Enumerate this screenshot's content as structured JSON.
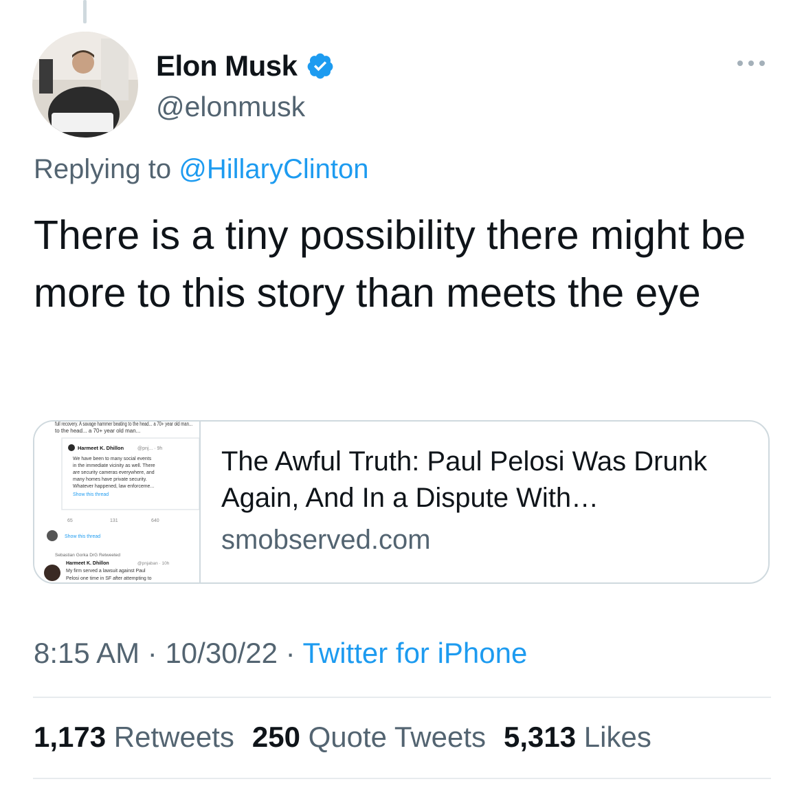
{
  "tweet": {
    "author": {
      "display_name": "Elon Musk",
      "handle": "@elonmusk",
      "verified": true
    },
    "replying_to_prefix": "Replying to",
    "replying_to_handle": "@HillaryClinton",
    "text": "There is a tiny possibility there might be more to this story than meets the eye",
    "card": {
      "title": "The Awful Truth: Paul Pelosi Was Drunk Again, And In a Dispute With…",
      "domain": "smobserved.com",
      "thumbnail": {
        "top_text": "full recovery. A savage hammer beating to the head... a 70+ year old man...",
        "post1_name": "Harmeet K. Dhillon",
        "post1_meta": "@pnj... · 9h",
        "post1_body": "We have been to many social events in the immediate vicinity as well. There are security cameras everywhere, and many homes have private security. Whatever happened, law enforceme...",
        "show_thread_1": "Show this thread",
        "counts": [
          "65",
          "131",
          "640"
        ],
        "show_thread_2": "Show this thread",
        "retweeted_by": "Sebastian Gorka DrG Retweeted",
        "post2_name": "Harmeet K. Dhillon",
        "post2_meta": "@pnjaban · 10h",
        "post2_body": "My firm served a lawsuit against Paul Pelosi one time in SF after attempting to"
      }
    },
    "time": "8:15 AM",
    "date": "10/30/22",
    "separator": "·",
    "source": "Twitter for iPhone",
    "stats": {
      "retweets_count": "1,173",
      "retweets_label": "Retweets",
      "quotes_count": "250",
      "quotes_label": "Quote Tweets",
      "likes_count": "5,313",
      "likes_label": "Likes"
    }
  },
  "colors": {
    "link": "#1d9bf0",
    "secondary": "#536471",
    "primary": "#0f1419",
    "border": "#cfd9de"
  },
  "icons": {
    "verified": "verified-badge-icon",
    "more": "more-icon"
  }
}
